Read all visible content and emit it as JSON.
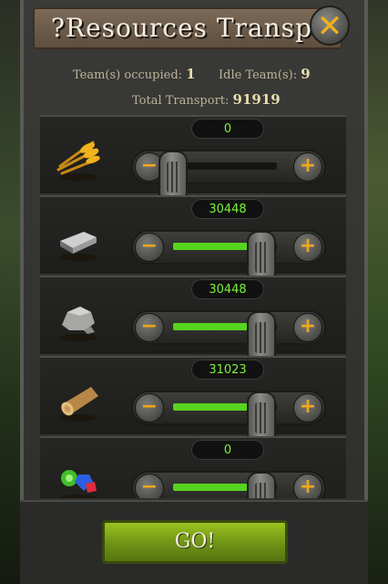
{
  "dialog": {
    "title": "?Resources Transpo",
    "close_label": "✕"
  },
  "info": {
    "teams_occupied_label": "Team(s) occupied:",
    "teams_occupied_value": "1",
    "idle_teams_label": "Idle Team(s):",
    "idle_teams_value": "9",
    "total_transport_label": "Total Transport:",
    "total_transport_value": "91919"
  },
  "resources": [
    {
      "name": "wheat",
      "icon": "wheat-icon",
      "value": "0",
      "fill_fraction": 0.0
    },
    {
      "name": "iron",
      "icon": "iron-ingot-icon",
      "value": "30448",
      "fill_fraction": 0.85
    },
    {
      "name": "stone",
      "icon": "stone-icon",
      "value": "30448",
      "fill_fraction": 0.85
    },
    {
      "name": "wood",
      "icon": "wood-log-icon",
      "value": "31023",
      "fill_fraction": 0.85
    },
    {
      "name": "gems",
      "icon": "gems-icon",
      "value": "0",
      "fill_fraction": 0.85
    }
  ],
  "controls": {
    "minus_label": "−",
    "plus_label": "+"
  },
  "go_button": {
    "label": "GO!"
  },
  "colors": {
    "value_text": "#7cf23a",
    "slider_fill": "#56d41e",
    "accent": "#f0a818",
    "go_button": "#7fa71a"
  }
}
